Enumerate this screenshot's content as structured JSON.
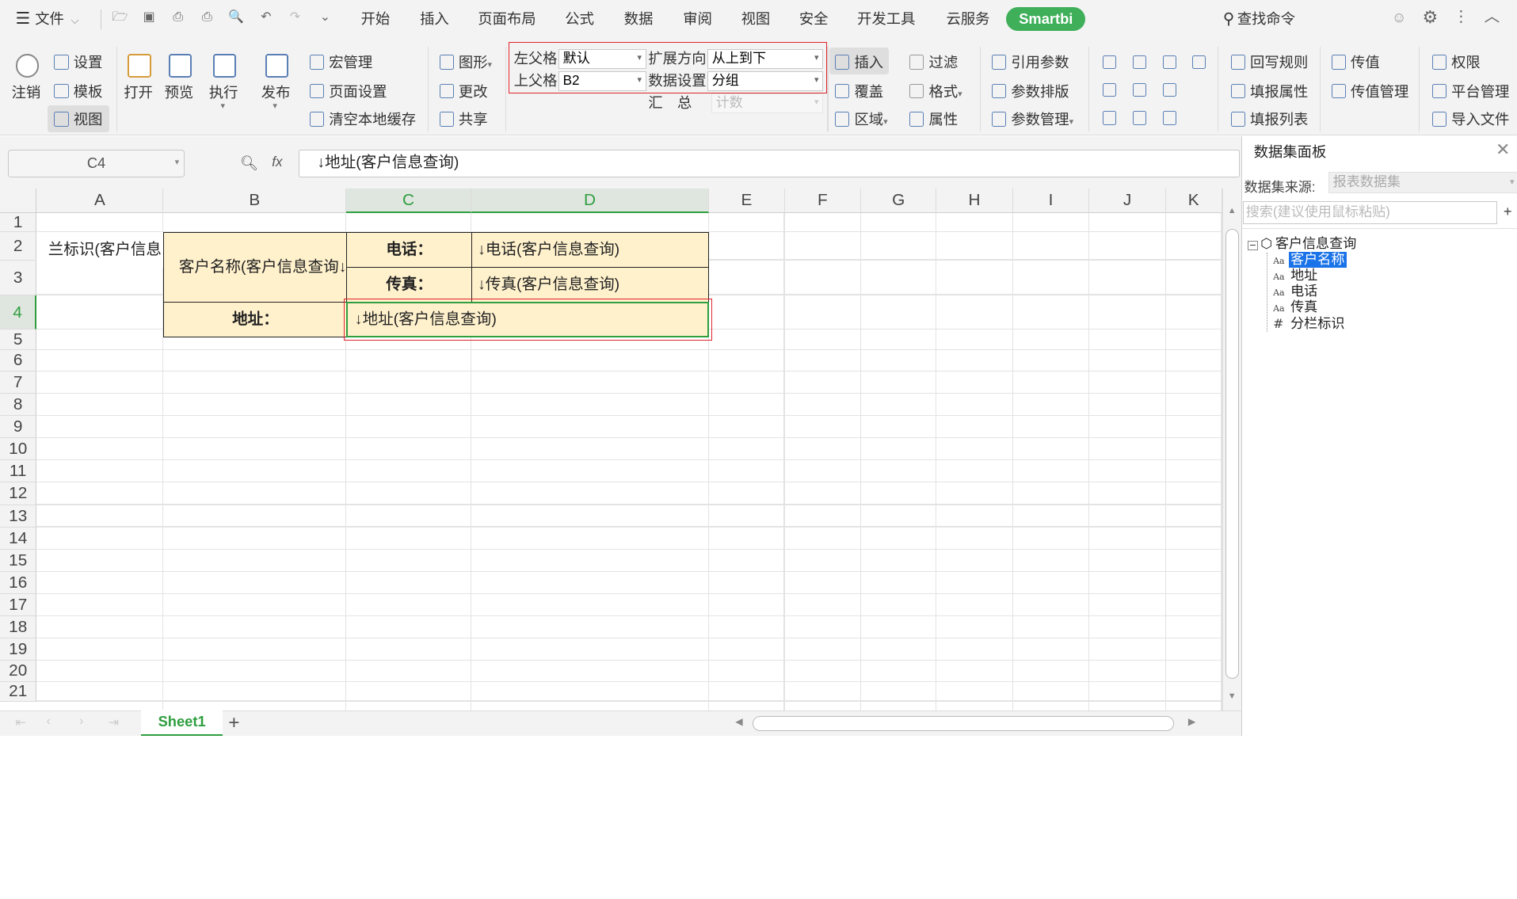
{
  "titlebar": {
    "file_menu": "文件",
    "tabs": [
      "开始",
      "插入",
      "页面布局",
      "公式",
      "数据",
      "审阅",
      "视图",
      "安全",
      "开发工具",
      "云服务"
    ],
    "smartbi_tab": "Smartbi",
    "search": "查找命令"
  },
  "ribbon": {
    "logout": "注销",
    "settings": "设置",
    "template": "模板",
    "view": "视图",
    "open": "打开",
    "preview": "预览",
    "execute": "执行",
    "publish": "发布",
    "macro": "宏管理",
    "page_setup": "页面设置",
    "clear_cache": "清空本地缓存",
    "graph": "图形",
    "change": "更改",
    "share": "共享",
    "left_parent_label": "左父格",
    "left_parent_value": "默认",
    "top_parent_label": "上父格",
    "top_parent_value": "B2",
    "expand_dir_label": "扩展方向",
    "expand_dir_value": "从上到下",
    "data_setting_label": "数据设置",
    "data_setting_value": "分组",
    "summary_label": "汇　总",
    "summary_value": "计数",
    "insert": "插入",
    "cover": "覆盖",
    "region": "区域",
    "filter": "过滤",
    "format": "格式",
    "property": "属性",
    "ref_param": "引用参数",
    "param_layout": "参数排版",
    "param_manage": "参数管理",
    "writeback_rule": "回写规则",
    "fill_property": "填报属性",
    "fill_list": "填报列表",
    "pass_value": "传值",
    "pass_value_manage": "传值管理",
    "permission": "权限",
    "platform_manage": "平台管理",
    "import_file": "导入文件"
  },
  "formula_bar": {
    "cell_ref": "C4",
    "fx": "fx",
    "content": "↓地址(客户信息查询)"
  },
  "grid": {
    "columns": [
      "A",
      "B",
      "C",
      "D",
      "E",
      "F",
      "G",
      "H",
      "I",
      "J",
      "K"
    ],
    "rows": [
      "1",
      "2",
      "3",
      "4",
      "5",
      "6",
      "7",
      "8",
      "9",
      "10",
      "11",
      "12",
      "13",
      "14",
      "15",
      "16",
      "17",
      "18",
      "19",
      "20",
      "21"
    ],
    "a2": "兰标识(客户信息",
    "b2": "↓客户名称(客户信息查询",
    "c2": "电话：",
    "d2": "↓电话(客户信息查询)",
    "c3": "传真：",
    "d3": "↓传真(客户信息查询)",
    "b4": "地址：",
    "c4": "↓地址(客户信息查询)"
  },
  "sheets": {
    "active": "Sheet1",
    "add": "+"
  },
  "panel": {
    "title": "数据集面板",
    "source_label": "数据集来源:",
    "source_value": "报表数据集",
    "search_placeholder": "搜索(建议使用鼠标粘贴)",
    "dataset": "客户信息查询",
    "fields": [
      "客户名称",
      "地址",
      "电话",
      "传真",
      "分栏标识"
    ]
  },
  "colors": {
    "accent_green": "#3faf5a",
    "cell_fill": "#fff1cc",
    "highlight": "#e0232b",
    "selection": "#2f9e3f"
  }
}
